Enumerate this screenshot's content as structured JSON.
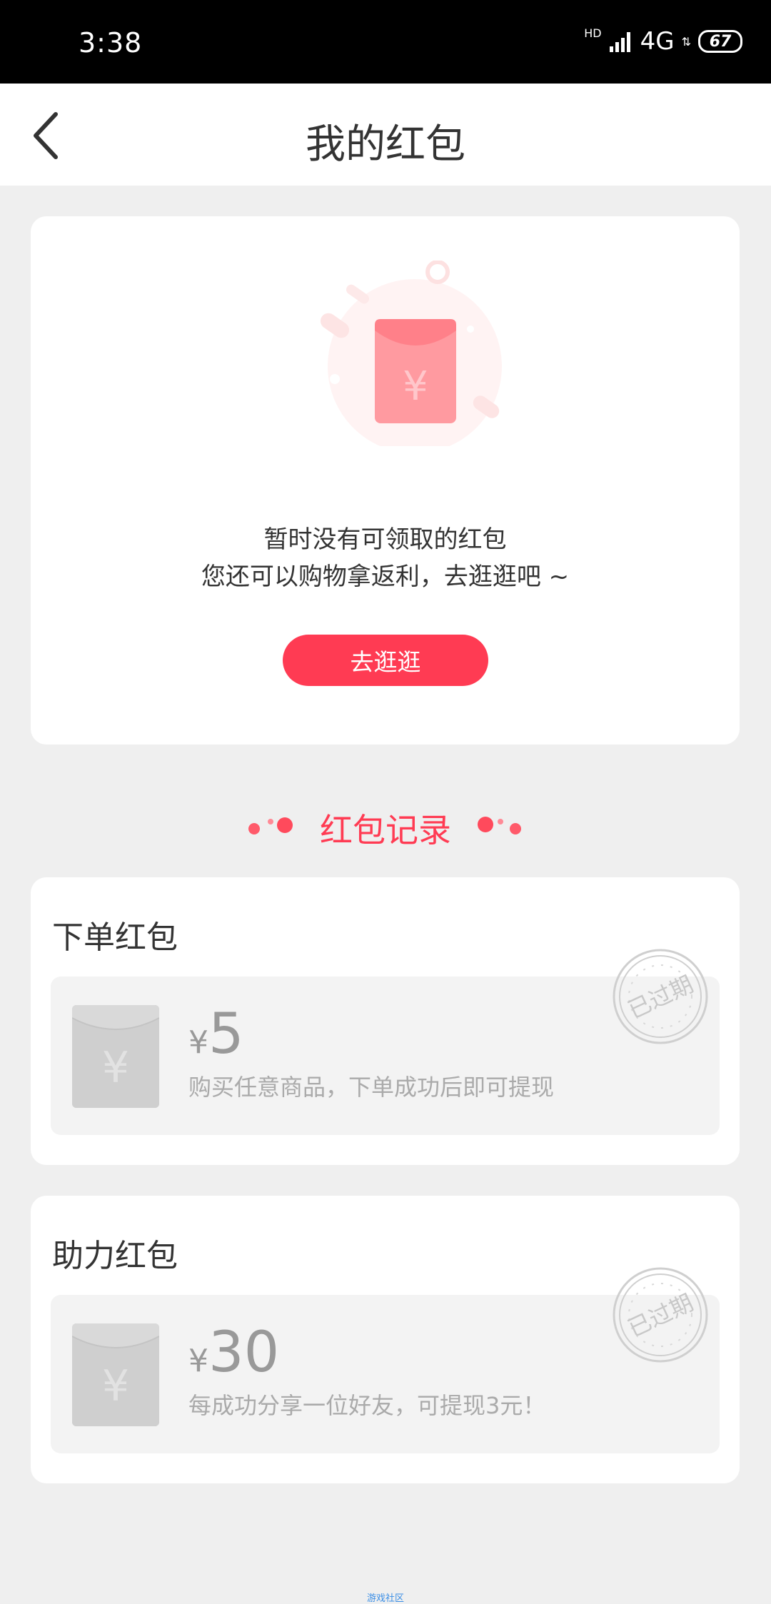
{
  "status_bar": {
    "time": "3:38",
    "network": "4G",
    "hd": "HD",
    "battery": "67"
  },
  "header": {
    "title": "我的红包",
    "back_icon": "chevron-left-icon"
  },
  "empty_state": {
    "line1": "暂时没有可领取的红包",
    "line2": "您还可以购物拿返利，去逛逛吧 ~",
    "button_label": "去逛逛"
  },
  "records": {
    "title": "红包记录",
    "items": [
      {
        "heading": "下单红包",
        "currency": "¥",
        "amount": "5",
        "description": "购买任意商品，下单成功后即可提现",
        "stamp": "已过期"
      },
      {
        "heading": "助力红包",
        "currency": "¥",
        "amount": "30",
        "description": "每成功分享一位好友，可提现3元！",
        "stamp": "已过期"
      }
    ]
  },
  "footer": {
    "watermark": "游戏社区"
  },
  "colors": {
    "accent": "#ff3b53",
    "background": "#efefef"
  }
}
